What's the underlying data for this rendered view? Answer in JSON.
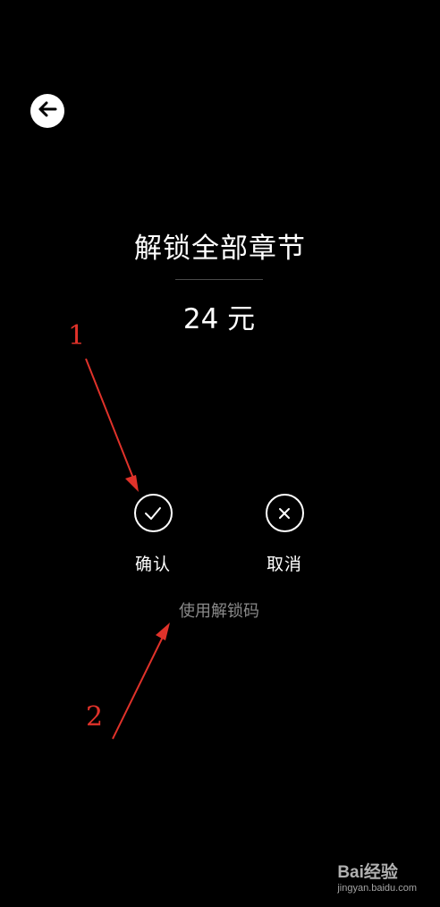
{
  "title": "解锁全部章节",
  "price": "24 元",
  "actions": {
    "confirm_label": "确认",
    "cancel_label": "取消"
  },
  "unlock_code_label": "使用解锁码",
  "annotations": {
    "marker_1": "1",
    "marker_2": "2"
  },
  "watermark": {
    "logo": "Bai经验",
    "sub": "jingyan.baidu.com"
  },
  "colors": {
    "background": "#000000",
    "text": "#ffffff",
    "muted_text": "#8a8a8a",
    "annotation": "#e0322a"
  },
  "icons": {
    "back": "arrow-left-icon",
    "confirm": "check-icon",
    "cancel": "close-icon"
  }
}
